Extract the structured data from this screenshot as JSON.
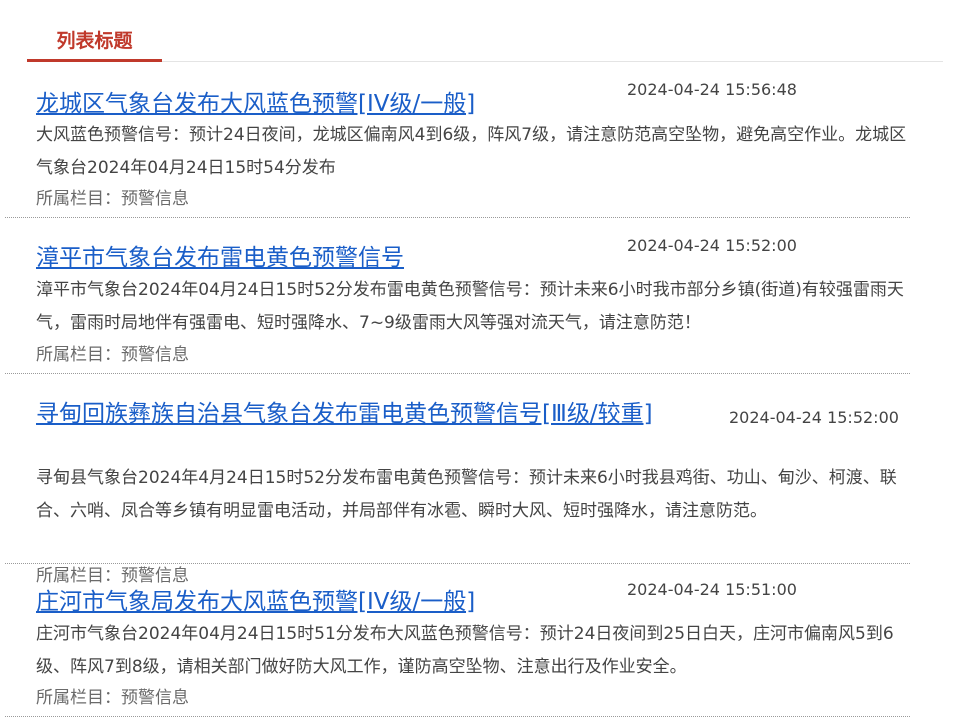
{
  "header": {
    "tab_title": "列表标题"
  },
  "items": [
    {
      "title": "龙城区气象台发布大风蓝色预警[IV级/一般]",
      "date": "2024-04-24 15:56:48",
      "summary": "大风蓝色预警信号：预计24日夜间，龙城区偏南风4到6级，阵风7级，请注意防范高空坠物，避免高空作业。龙城区气象台2024年04月24日15时54分发布",
      "category": "所属栏目：预警信息"
    },
    {
      "title": "漳平市气象台发布雷电黄色预警信号",
      "date": "2024-04-24 15:52:00",
      "summary": "漳平市气象台2024年04月24日15时52分发布雷电黄色预警信号：预计未来6小时我市部分乡镇(街道)有较强雷雨天气，雷雨时局地伴有强雷电、短时强降水、7~9级雷雨大风等强对流天气，请注意防范！",
      "category": "所属栏目：预警信息"
    },
    {
      "title": "寻甸回族彝族自治县气象台发布雷电黄色预警信号[Ⅲ级/较重]",
      "date": "2024-04-24 15:52:00",
      "summary": "寻甸县气象台2024年4月24日15时52分发布雷电黄色预警信号：预计未来6小时我县鸡街、功山、甸沙、柯渡、联合、六哨、凤合等乡镇有明显雷电活动，并局部伴有冰雹、瞬时大风、短时强降水，请注意防范。",
      "category": "所属栏目：预警信息"
    },
    {
      "title": "庄河市气象局发布大风蓝色预警[IV级/一般]",
      "date": "2024-04-24 15:51:00",
      "summary": "庄河市气象台2024年04月24日15时51分发布大风蓝色预警信号：预计24日夜间到25日白天，庄河市偏南风5到6级、阵风7到8级，请相关部门做好防大风工作，谨防高空坠物、注意出行及作业安全。",
      "category": "所属栏目：预警信息"
    }
  ]
}
